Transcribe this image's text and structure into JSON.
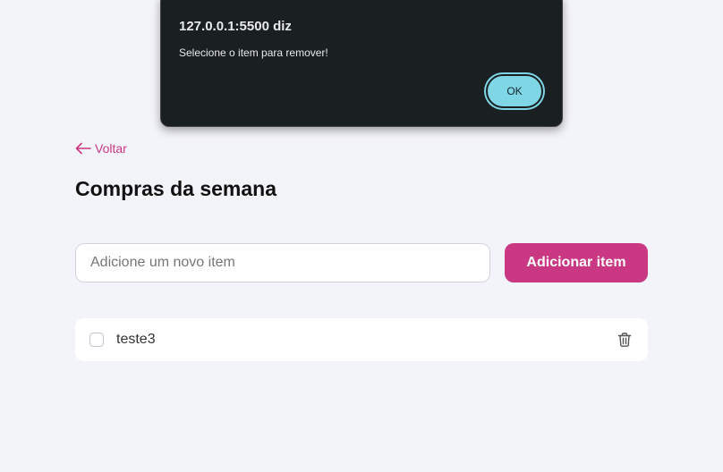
{
  "alert": {
    "origin": "127.0.0.1:5500 diz",
    "message": "Selecione o item para remover!",
    "ok_label": "OK"
  },
  "nav": {
    "back_label": "Voltar",
    "back_icon": "arrow-left-icon"
  },
  "page": {
    "title": "Compras da semana"
  },
  "form": {
    "input_placeholder": "Adicione um novo item",
    "input_value": "",
    "add_button_label": "Adicionar item"
  },
  "items": [
    {
      "label": "teste3",
      "checked": false,
      "delete_icon": "trash-icon"
    }
  ],
  "colors": {
    "accent": "#ca3884",
    "background": "#f3f4f9",
    "dialog_background": "#1a1f22",
    "dialog_button": "#7fd7e6"
  }
}
